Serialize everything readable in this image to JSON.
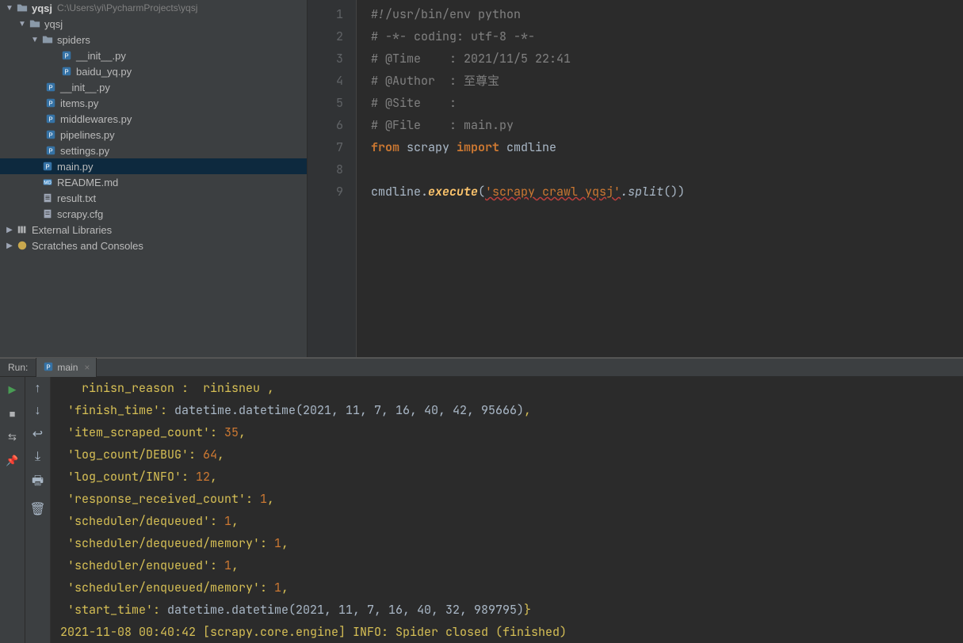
{
  "project": {
    "name": "yqsj",
    "path": "C:\\Users\\yi\\PycharmProjects\\yqsj"
  },
  "tree": {
    "root": {
      "label": "yqsj"
    },
    "sub": {
      "label": "yqsj"
    },
    "spiders": {
      "label": "spiders"
    },
    "files": {
      "init_spiders": "__init__.py",
      "baidu_yq": "baidu_yq.py",
      "init": "__init__.py",
      "items": "items.py",
      "middlewares": "middlewares.py",
      "pipelines": "pipelines.py",
      "settings": "settings.py",
      "main": "main.py",
      "readme": "README.md",
      "result": "result.txt",
      "scrapy_cfg": "scrapy.cfg"
    },
    "external_libs": "External Libraries",
    "scratches": "Scratches and Consoles"
  },
  "editor": {
    "lines": [
      "1",
      "2",
      "3",
      "4",
      "5",
      "6",
      "7",
      "8",
      "9"
    ],
    "code": {
      "l1": "#!/usr/bin/env python",
      "l2": "# -*- coding: utf-8 -*-",
      "l3": "# @Time    : 2021/11/5 22:41",
      "l4": "# @Author  : 至尊宝",
      "l5": "# @Site    : ",
      "l6": "# @File    : main.py",
      "l7_from": "from",
      "l7_scrapy": " scrapy ",
      "l7_import": "import",
      "l7_cmdline": " cmdline",
      "l8": "",
      "l9_cmdline": "cmdline.",
      "l9_execute": "execute",
      "l9_open": "(",
      "l9_str": "'scrapy crawl yqsj'",
      "l9_split": ".split",
      "l9_close": "())"
    }
  },
  "run": {
    "label": "Run:",
    "tab_name": "main"
  },
  "console": {
    "l0": "   rinisn_reason :  rinisneu ,",
    "l1_a": " 'finish_time': ",
    "l1_b": "datetime.datetime(2021, 11, 7, 16, 40, 42, 95666)",
    "l1_c": ",",
    "l2_a": " 'item_scraped_count': ",
    "l2_b": "35",
    "l2_c": ",",
    "l3_a": " 'log_count/DEBUG': ",
    "l3_b": "64",
    "l3_c": ",",
    "l4_a": " 'log_count/INFO': ",
    "l4_b": "12",
    "l4_c": ",",
    "l5_a": " 'response_received_count': ",
    "l5_b": "1",
    "l5_c": ",",
    "l6_a": " 'scheduler/dequeued': ",
    "l6_b": "1",
    "l6_c": ",",
    "l7_a": " 'scheduler/dequeued/memory': ",
    "l7_b": "1",
    "l7_c": ",",
    "l8_a": " 'scheduler/enqueued': ",
    "l8_b": "1",
    "l8_c": ",",
    "l9_a": " 'scheduler/enqueued/memory': ",
    "l9_b": "1",
    "l9_c": ",",
    "l10_a": " 'start_time': ",
    "l10_b": "datetime.datetime(2021, 11, 7, 16, 40, 32, 989795)",
    "l10_c": "}",
    "l11": "2021-11-08 00:40:42 [scrapy.core.engine] INFO: Spider closed (finished)"
  }
}
